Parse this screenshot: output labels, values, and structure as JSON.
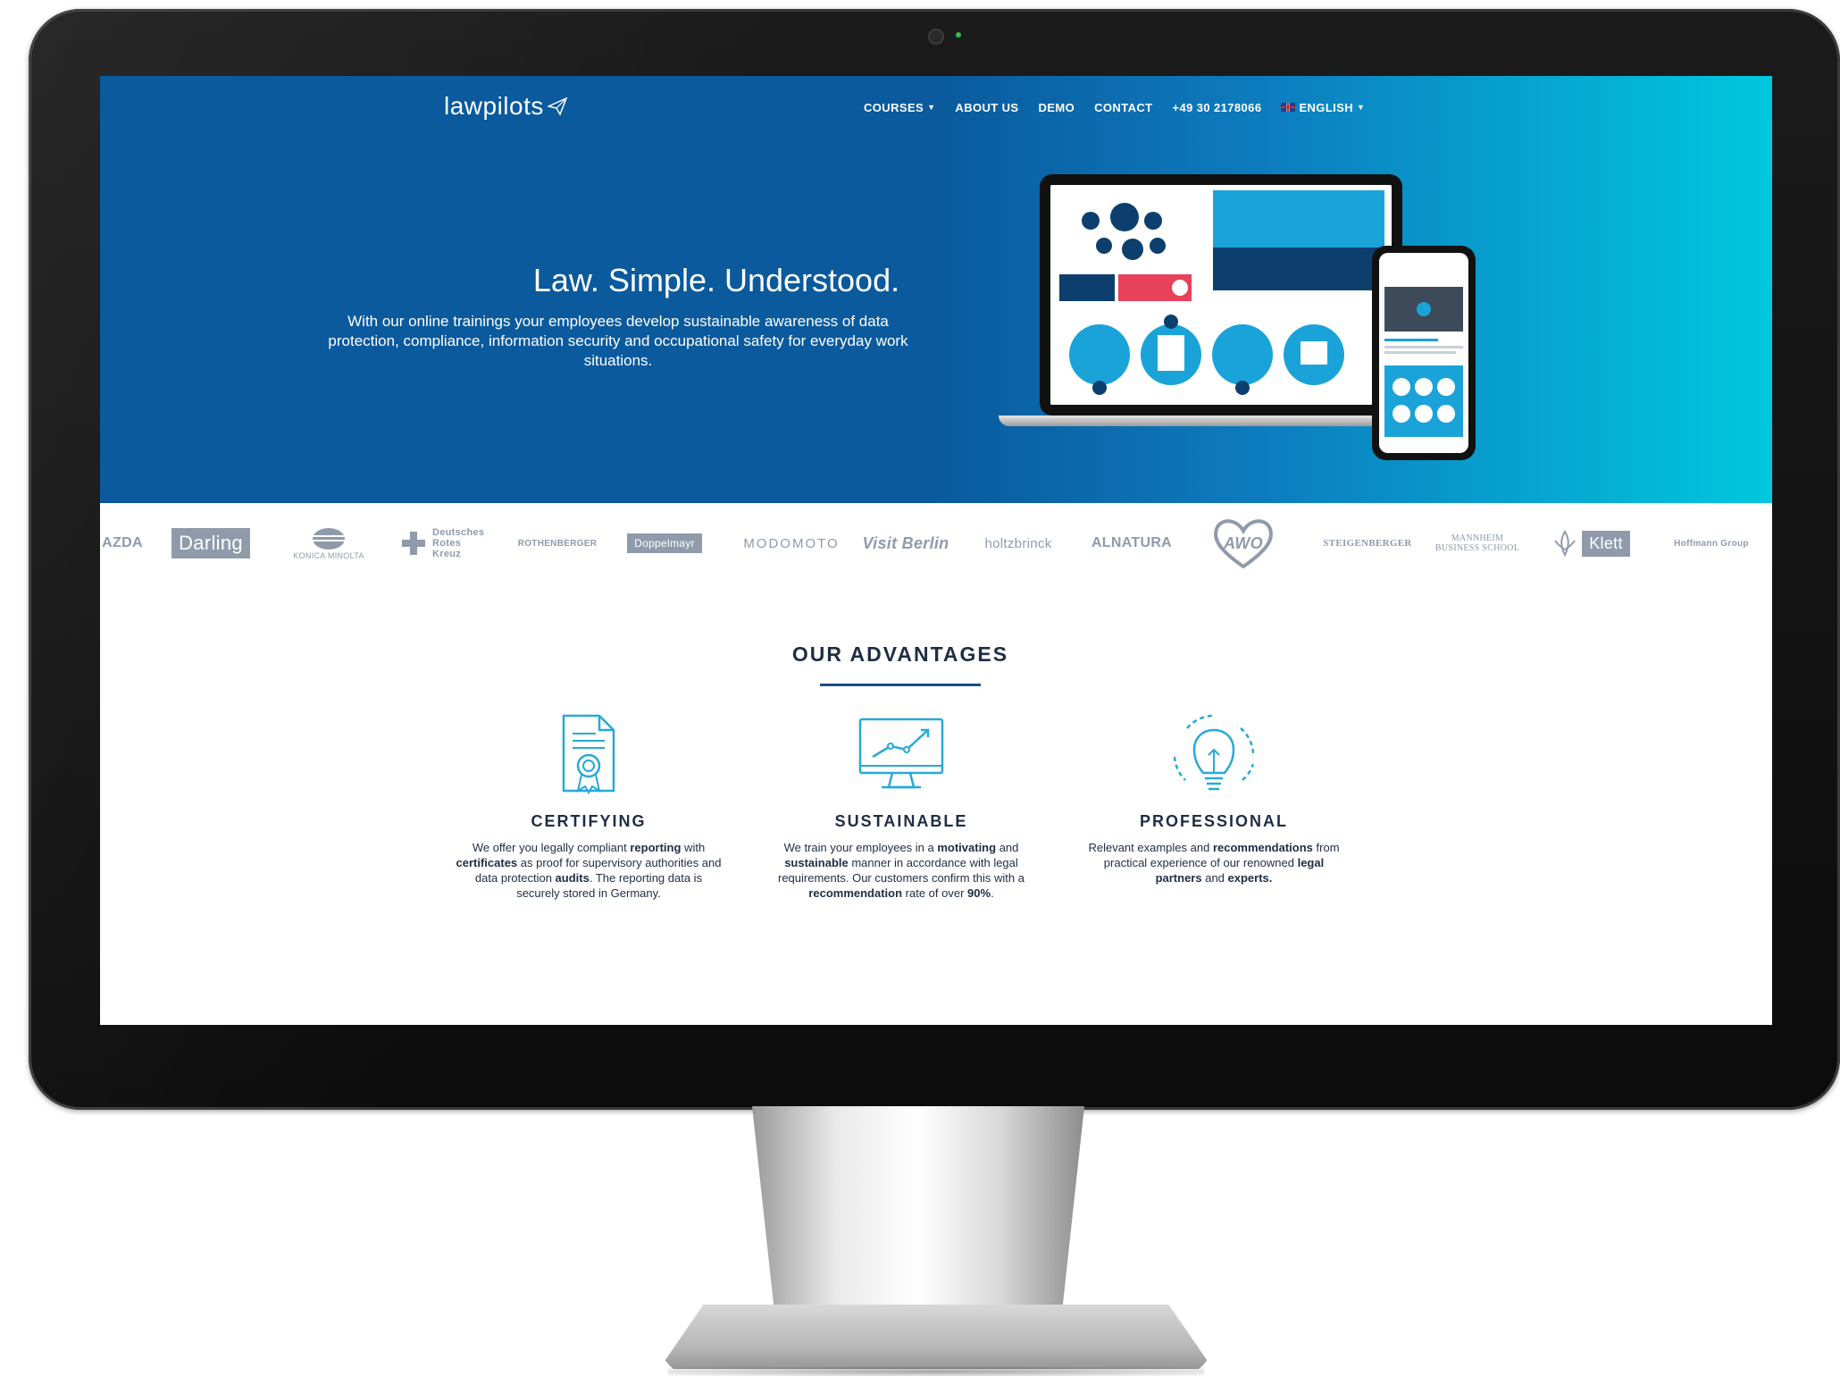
{
  "site": {
    "logo": "lawpilots"
  },
  "nav": {
    "items": [
      {
        "label": "COURSES",
        "caret": true
      },
      {
        "label": "ABOUT US",
        "caret": false
      },
      {
        "label": "DEMO",
        "caret": false
      },
      {
        "label": "CONTACT",
        "caret": false
      },
      {
        "label": "+49 30 2178066",
        "caret": false
      },
      {
        "label": "ENGLISH",
        "caret": true
      }
    ]
  },
  "hero": {
    "title": "Law. Simple. Understood.",
    "subtitle": "With our online trainings your employees develop sustainable awareness of data protection, compliance, information security and occupational safety for everyday work situations."
  },
  "partners": [
    "AZDA",
    "Darling",
    "KONICA MINOLTA",
    "Deutsches Rotes Kreuz",
    "ROTHENBERGER",
    "Doppelmayr",
    "MODOMOTO",
    "Visit Berlin",
    "holtzbrinck",
    "ALNATURA",
    "AWO",
    "STEIGENBERGER",
    "MANNHEIM BUSINESS SCHOOL",
    "Klett",
    "Hoffmann Group"
  ],
  "advantages": {
    "title": "OUR ADVANTAGES",
    "items": [
      {
        "icon": "certificate-icon",
        "heading": "CERTIFYING",
        "text_parts": [
          {
            "t": "We offer you legally compliant ",
            "b": false
          },
          {
            "t": "reporting",
            "b": true
          },
          {
            "t": " with ",
            "b": false
          },
          {
            "t": "certificates",
            "b": true
          },
          {
            "t": " as proof for supervisory authorities and data protection ",
            "b": false
          },
          {
            "t": "audits",
            "b": true
          },
          {
            "t": ". The reporting data is securely stored in Germany.",
            "b": false
          }
        ]
      },
      {
        "icon": "monitor-chart-icon",
        "heading": "SUSTAINABLE",
        "text_parts": [
          {
            "t": "We train your employees in a ",
            "b": false
          },
          {
            "t": "motivating",
            "b": true
          },
          {
            "t": " and ",
            "b": false
          },
          {
            "t": "sustainable",
            "b": true
          },
          {
            "t": " manner in accordance with legal requirements. Our customers confirm this with a ",
            "b": false
          },
          {
            "t": "recommendation",
            "b": true
          },
          {
            "t": " rate of over ",
            "b": false
          },
          {
            "t": "90%",
            "b": true
          },
          {
            "t": ".",
            "b": false
          }
        ]
      },
      {
        "icon": "lightbulb-icon",
        "heading": "PROFESSIONAL",
        "text_parts": [
          {
            "t": "Relevant examples and ",
            "b": false
          },
          {
            "t": "recommendations",
            "b": true
          },
          {
            "t": " from practical experience of our renowned ",
            "b": false
          },
          {
            "t": "legal partners",
            "b": true
          },
          {
            "t": " and ",
            "b": false
          },
          {
            "t": "experts.",
            "b": true
          }
        ]
      }
    ]
  },
  "colors": {
    "hero_start": "#0a5a9d",
    "hero_end": "#00c8de",
    "text_dark": "#1f2d45",
    "accent": "#1d4e86",
    "icon_blue": "#27a9d8",
    "logo_gray": "#8f9bab"
  }
}
